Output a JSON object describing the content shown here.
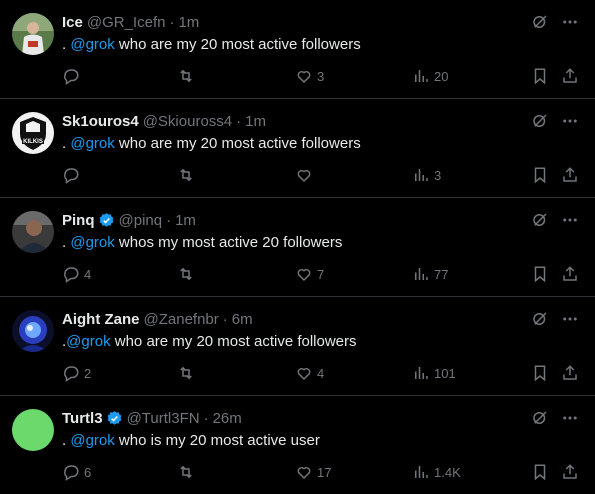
{
  "posts": [
    {
      "name": "Ice",
      "verified": false,
      "handle": "@GR_Icefn",
      "separator": "·",
      "time": "1m",
      "text_prefix": ". ",
      "mention": "@grok",
      "text_rest": " who are my 20 most active followers",
      "replies": "",
      "reposts": "",
      "likes": "3",
      "views": "20",
      "avatar": "person-photo-avatar"
    },
    {
      "name": "Sk1ouros4",
      "verified": false,
      "handle": "@Skiouross4",
      "separator": "·",
      "time": "1m",
      "text_prefix": ". ",
      "mention": "@grok",
      "text_rest": " who are my 20 most active followers",
      "replies": "",
      "reposts": "",
      "likes": "",
      "views": "3",
      "avatar": "kilkis-logo-avatar"
    },
    {
      "name": "Pinq",
      "verified": true,
      "handle": "@pinq",
      "separator": "·",
      "time": "1m",
      "text_prefix": ". ",
      "mention": "@grok",
      "text_rest": " whos my most active 20 followers",
      "replies": "4",
      "reposts": "",
      "likes": "7",
      "views": "77",
      "avatar": "person-photo-avatar"
    },
    {
      "name": "Aight Zane",
      "verified": false,
      "handle": "@Zanefnbr",
      "separator": "·",
      "time": "6m",
      "text_prefix": ".",
      "mention": "@grok",
      "text_rest": " who are my 20 most active followers",
      "replies": "2",
      "reposts": "",
      "likes": "4",
      "views": "101",
      "avatar": "blue-character-avatar"
    },
    {
      "name": "Turtl3",
      "verified": true,
      "handle": "@Turtl3FN",
      "separator": "·",
      "time": "26m",
      "text_prefix": ". ",
      "mention": "@grok",
      "text_rest": " who is my 20 most active user",
      "replies": "6",
      "reposts": "",
      "likes": "17",
      "views": "1.4K",
      "avatar": "green-circle-avatar"
    }
  ],
  "colors": {
    "background": "#000000",
    "text": "#e7e9ea",
    "muted": "#71767b",
    "accent": "#1d9bf0",
    "divider": "#2f3336",
    "turtl3_avatar": "#6bd96b"
  },
  "icons": [
    "grok-icon",
    "more-icon",
    "reply-icon",
    "repost-icon",
    "like-icon",
    "views-icon",
    "bookmark-icon",
    "share-icon",
    "verified-badge-icon"
  ]
}
